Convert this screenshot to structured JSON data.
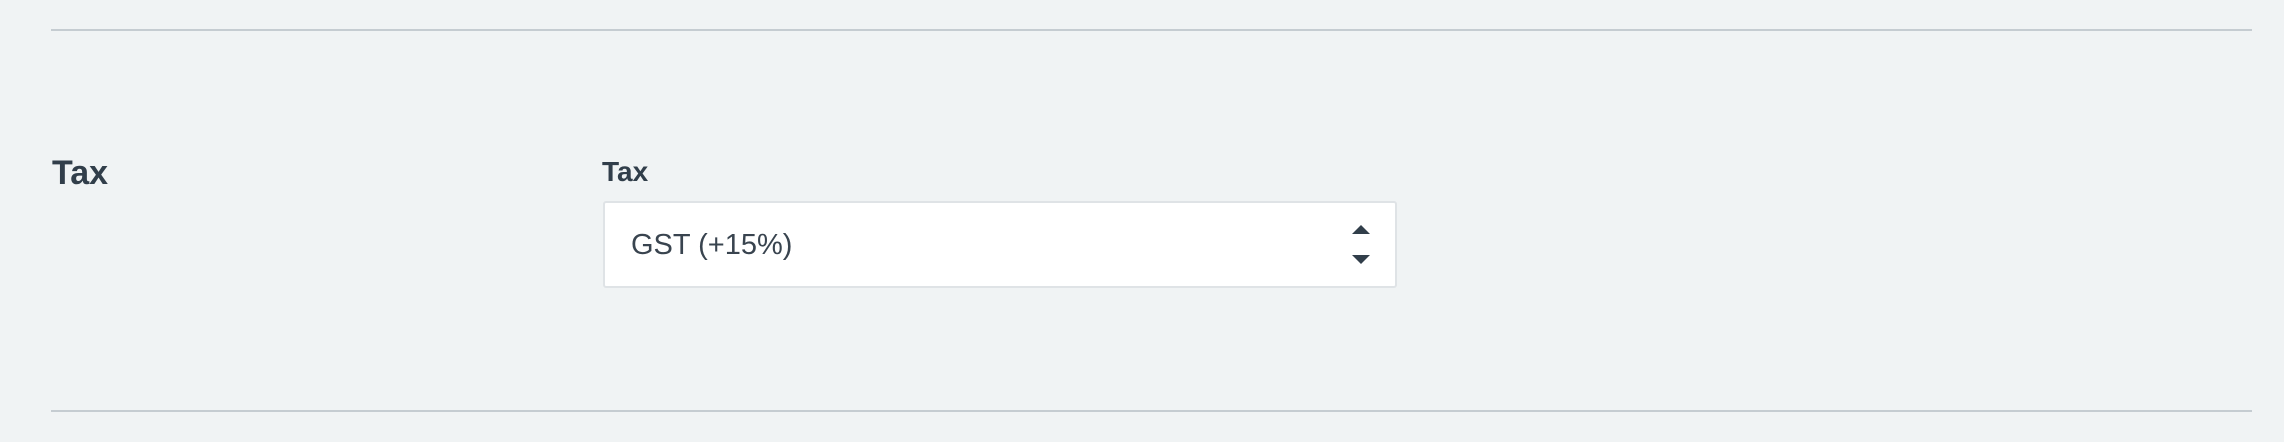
{
  "section": {
    "title": "Tax"
  },
  "tax_field": {
    "label": "Tax",
    "selected_value": "GST (+15%)"
  },
  "colors": {
    "background": "#f0f3f4",
    "text": "#313e4a",
    "divider": "#c5ccd1",
    "input_background": "#ffffff",
    "input_border": "#dfe3e6"
  },
  "icons": {
    "select_arrows": "up-down-chevron-icon"
  }
}
